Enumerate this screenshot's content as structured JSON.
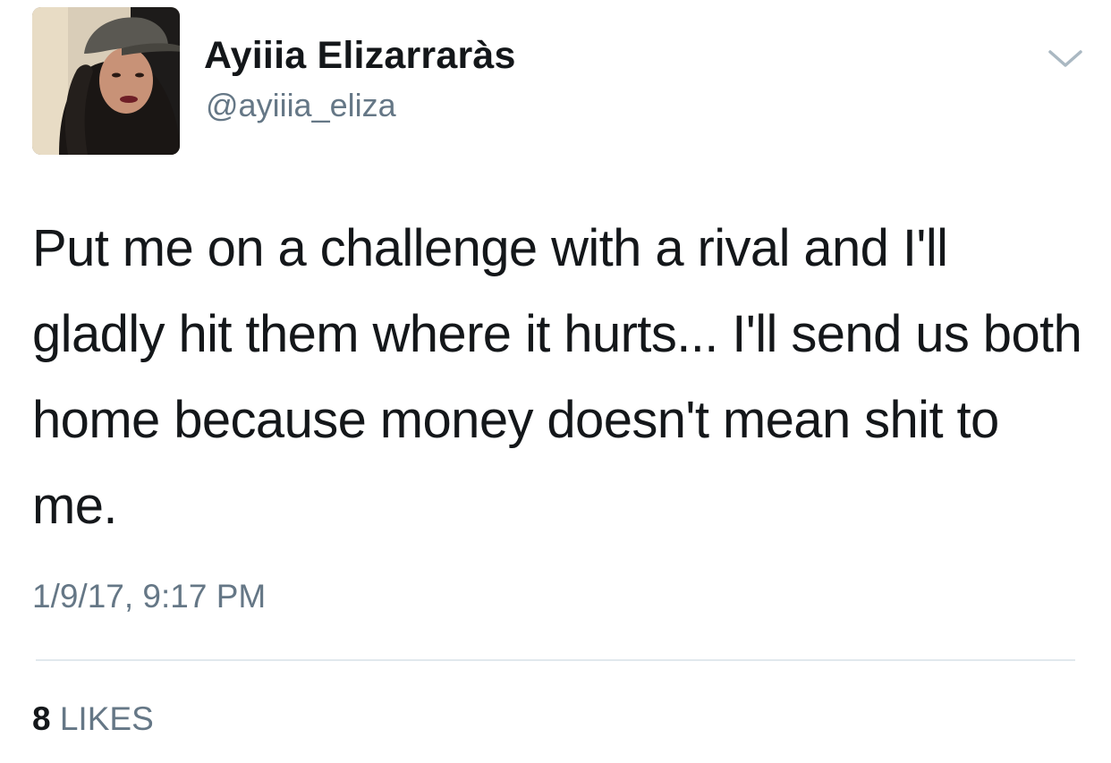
{
  "tweet": {
    "author": {
      "display_name": "Ayiiia Elizarraràs",
      "handle": "@ayiiia_eliza",
      "avatar_icon": "profile-photo"
    },
    "text": "Put me on a challenge with a rival and I'll gladly hit them where it hurts... I'll send us both home because money doesn't mean shit to me.",
    "timestamp": "1/9/17, 9:17 PM",
    "likes": {
      "count": "8",
      "label": "LIKES"
    },
    "menu_icon": "chevron-down-icon"
  },
  "colors": {
    "text_primary": "#14171a",
    "text_secondary": "#657786",
    "divider": "#e1e8ed",
    "background": "#ffffff"
  }
}
